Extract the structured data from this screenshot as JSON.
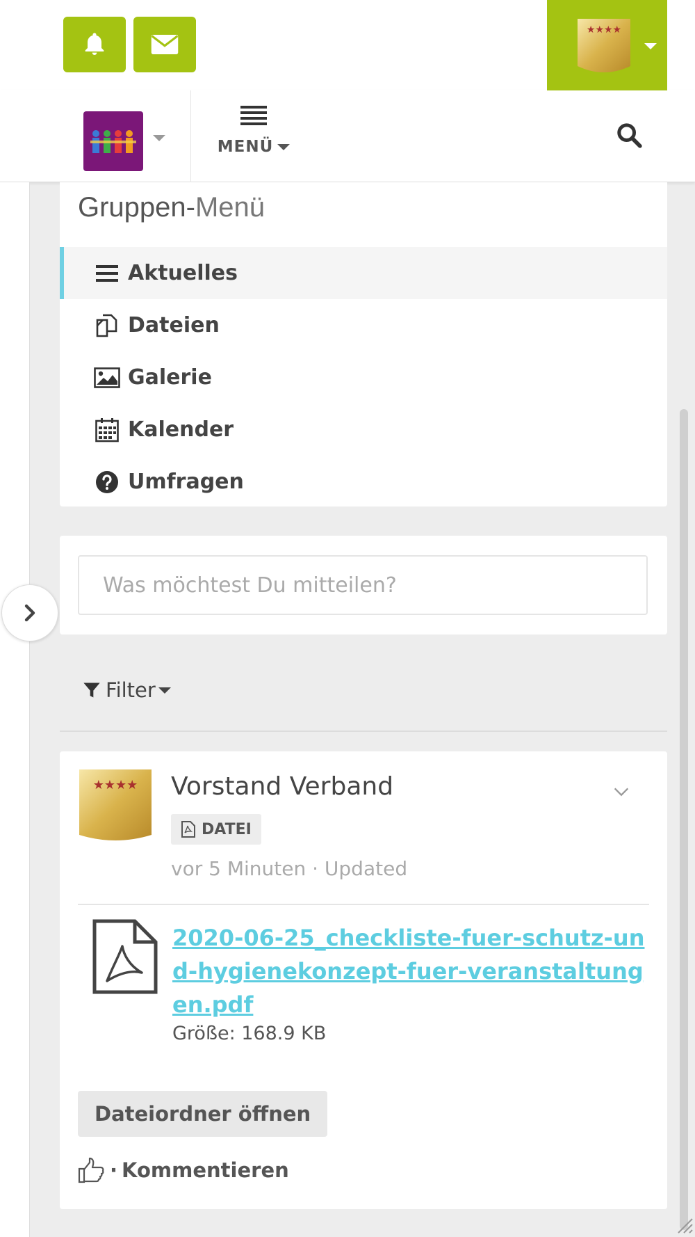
{
  "colors": {
    "brand_green": "#a4c312",
    "accent_cyan": "#5dcde0",
    "space_purple": "#7b1778",
    "active_bar": "#6fd0e3"
  },
  "topbar": {
    "notifications_icon": "bell-icon",
    "messages_icon": "envelope-icon"
  },
  "navbar": {
    "menu_label": "MENÜ",
    "search_icon": "search-icon"
  },
  "group_menu": {
    "title_bold": "Gruppen-",
    "title_light": "Menü",
    "items": [
      {
        "label": "Aktuelles",
        "icon": "list-icon",
        "active": true
      },
      {
        "label": "Dateien",
        "icon": "files-icon",
        "active": false
      },
      {
        "label": "Galerie",
        "icon": "image-icon",
        "active": false
      },
      {
        "label": "Kalender",
        "icon": "calendar-icon",
        "active": false
      },
      {
        "label": "Umfragen",
        "icon": "question-icon",
        "active": false
      }
    ]
  },
  "composer": {
    "placeholder": "Was möchtest Du mitteilen?"
  },
  "filter": {
    "label": "Filter"
  },
  "entry": {
    "author": "Vorstand Verband",
    "type_label": "DATEI",
    "meta": "vor 5 Minuten · Updated",
    "file_name": "2020-06-25_checkliste-fuer-schutz-und-hygienekonzept-fuer-veranstaltungen.pdf",
    "file_size": "Größe: 168.9 KB",
    "folder_button": "Dateiordner öffnen",
    "separator": "·",
    "comment_label": "Kommentieren"
  }
}
